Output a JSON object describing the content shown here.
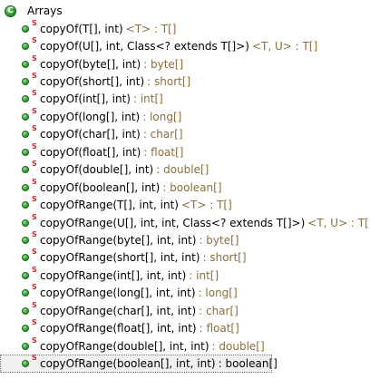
{
  "tree": {
    "root": {
      "label": "Arrays",
      "icon": "class-icon"
    },
    "items": [
      {
        "signature": "copyOf(T[], int)",
        "return": "<T> : T[]",
        "icon": "public-static-method-icon",
        "static_marker": "S"
      },
      {
        "signature": "copyOf(U[], int, Class<? extends T[]>)",
        "return": "<T, U> : T[]",
        "icon": "public-static-method-icon",
        "static_marker": "S"
      },
      {
        "signature": "copyOf(byte[], int)",
        "return": ": byte[]",
        "icon": "public-static-method-icon",
        "static_marker": "S"
      },
      {
        "signature": "copyOf(short[], int)",
        "return": ": short[]",
        "icon": "public-static-method-icon",
        "static_marker": "S"
      },
      {
        "signature": "copyOf(int[], int)",
        "return": ": int[]",
        "icon": "public-static-method-icon",
        "static_marker": "S"
      },
      {
        "signature": "copyOf(long[], int)",
        "return": ": long[]",
        "icon": "public-static-method-icon",
        "static_marker": "S"
      },
      {
        "signature": "copyOf(char[], int)",
        "return": ": char[]",
        "icon": "public-static-method-icon",
        "static_marker": "S"
      },
      {
        "signature": "copyOf(float[], int)",
        "return": ": float[]",
        "icon": "public-static-method-icon",
        "static_marker": "S"
      },
      {
        "signature": "copyOf(double[], int)",
        "return": ": double[]",
        "icon": "public-static-method-icon",
        "static_marker": "S"
      },
      {
        "signature": "copyOf(boolean[], int)",
        "return": ": boolean[]",
        "icon": "public-static-method-icon",
        "static_marker": "S"
      },
      {
        "signature": "copyOfRange(T[], int, int)",
        "return": "<T> : T[]",
        "icon": "public-static-method-icon",
        "static_marker": "S"
      },
      {
        "signature": "copyOfRange(U[], int, int, Class<? extends T[]>)",
        "return": "<T, U> : T[]",
        "icon": "public-static-method-icon",
        "static_marker": "S"
      },
      {
        "signature": "copyOfRange(byte[], int, int)",
        "return": ": byte[]",
        "icon": "public-static-method-icon",
        "static_marker": "S"
      },
      {
        "signature": "copyOfRange(short[], int, int)",
        "return": ": short[]",
        "icon": "public-static-method-icon",
        "static_marker": "S"
      },
      {
        "signature": "copyOfRange(int[], int, int)",
        "return": ": int[]",
        "icon": "public-static-method-icon",
        "static_marker": "S"
      },
      {
        "signature": "copyOfRange(long[], int, int)",
        "return": ": long[]",
        "icon": "public-static-method-icon",
        "static_marker": "S"
      },
      {
        "signature": "copyOfRange(char[], int, int)",
        "return": ": char[]",
        "icon": "public-static-method-icon",
        "static_marker": "S"
      },
      {
        "signature": "copyOfRange(float[], int, int)",
        "return": ": float[]",
        "icon": "public-static-method-icon",
        "static_marker": "S"
      },
      {
        "signature": "copyOfRange(double[], int, int)",
        "return": ": double[]",
        "icon": "public-static-method-icon",
        "static_marker": "S"
      },
      {
        "signature": "copyOfRange(boolean[], int, int)",
        "return": ": boolean[]",
        "icon": "public-static-method-icon",
        "static_marker": "S",
        "selected": true
      }
    ]
  },
  "colors": {
    "return_type": "#8f6d3b",
    "static_marker": "#c52a2a",
    "method_icon": "#34a534",
    "selection_background": "#f0f0f0"
  }
}
